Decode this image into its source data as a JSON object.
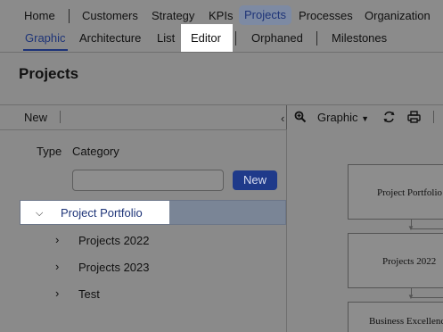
{
  "nav": {
    "items": [
      "Home",
      "Customers",
      "Strategy",
      "KPIs",
      "Projects",
      "Processes",
      "Organization"
    ],
    "active": "Projects"
  },
  "subnav": {
    "items": [
      "Graphic",
      "Architecture",
      "List",
      "Editor",
      "Orphaned",
      "Milestones"
    ],
    "active": "Graphic"
  },
  "page": {
    "title": "Projects"
  },
  "left_panel": {
    "new_button": "New",
    "type_label": "Type",
    "category_label": "Category",
    "input_value": "",
    "input_button": "New",
    "tree": [
      {
        "label": "Project Portfolio",
        "expanded": true,
        "selected": true
      },
      {
        "label": "Projects 2022",
        "expanded": false
      },
      {
        "label": "Projects 2023",
        "expanded": false
      },
      {
        "label": "Test",
        "expanded": false
      }
    ]
  },
  "right_panel": {
    "view_dropdown": "Graphic",
    "icons": [
      "zoom-in-icon",
      "refresh-icon",
      "print-icon"
    ],
    "nodes": [
      "Project Portfolio",
      "Projects 2022",
      "Business Excellence"
    ]
  },
  "colors": {
    "accent": "#1e3478",
    "button": "#1f3a8a",
    "overlay_bg": "#8a8a8a",
    "highlight": "#ffffff"
  }
}
